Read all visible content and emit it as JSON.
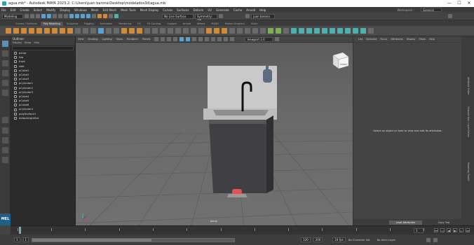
{
  "window": {
    "title": "agua.mb* - Autodesk MAYA 2023.2: C:\\Users\\juan barona\\Desktop\\modelados3d\\agua.mb",
    "minimize": "—",
    "maximize": "☐",
    "close": "✕"
  },
  "menu": [
    "File",
    "Edit",
    "Create",
    "Select",
    "Modify",
    "Display",
    "Windows",
    "Mesh",
    "Edit Mesh",
    "Mesh Tools",
    "Mesh Display",
    "Curves",
    "Surfaces",
    "Deform",
    "UV",
    "Generate",
    "Cache",
    "Arnold",
    "Help"
  ],
  "workspace": {
    "label": "Workspace :",
    "value": "General"
  },
  "status": {
    "menuset": "Modeling",
    "live": "No Live Surface",
    "symmetry": "Symmetry: Off",
    "user": "juan barona"
  },
  "shelf_tabs": [
    "Curves / Surfaces",
    "Poly Modeling",
    "Sculpting",
    "Rigging",
    "Animation",
    "Rendering",
    "FX",
    "FX Caching",
    "Custom",
    "Arnold",
    "Bifrost",
    "MASH",
    "Motion Graphics",
    "XGen"
  ],
  "shelf_active": "Poly Modeling",
  "outliner": {
    "title": "Outliner",
    "menus": [
      "Display",
      "Show",
      "Help"
    ],
    "items": [
      "persp",
      "top",
      "front",
      "side",
      "pCube1",
      "pCube2",
      "pCube3",
      "pCylinder1",
      "pCylinder2",
      "pCylinder3",
      "pCube4",
      "pCube5",
      "pCube6",
      "pCylinder4",
      "polySurface1",
      "defaultLightSet"
    ]
  },
  "viewport": {
    "menus": [
      "View",
      "Shading",
      "Lighting",
      "Show",
      "Renderer",
      "Panels"
    ],
    "camera": "persp",
    "renderer": "Viewport 2.0",
    "cube_label": "FRONT"
  },
  "attr_editor": {
    "tabs": [
      "List",
      "Selected",
      "Focus",
      "Attributes",
      "Display",
      "Show",
      "Help"
    ],
    "message": "Select an object or item to view and edit its attributes.",
    "load": "Load Attributes",
    "copy": "Copy Tab"
  },
  "right_tabs": [
    "Attribute Editor",
    "Channel Box / Layer Editor",
    "Modeling Toolkit"
  ],
  "time": {
    "start": "1",
    "end": "120",
    "current": "1",
    "range_start": "1",
    "range_end": "120",
    "anim_end": "200",
    "fps": "24 fps",
    "char": "No Character Set",
    "layer": "No Anim Layer"
  },
  "mel": "MEL"
}
